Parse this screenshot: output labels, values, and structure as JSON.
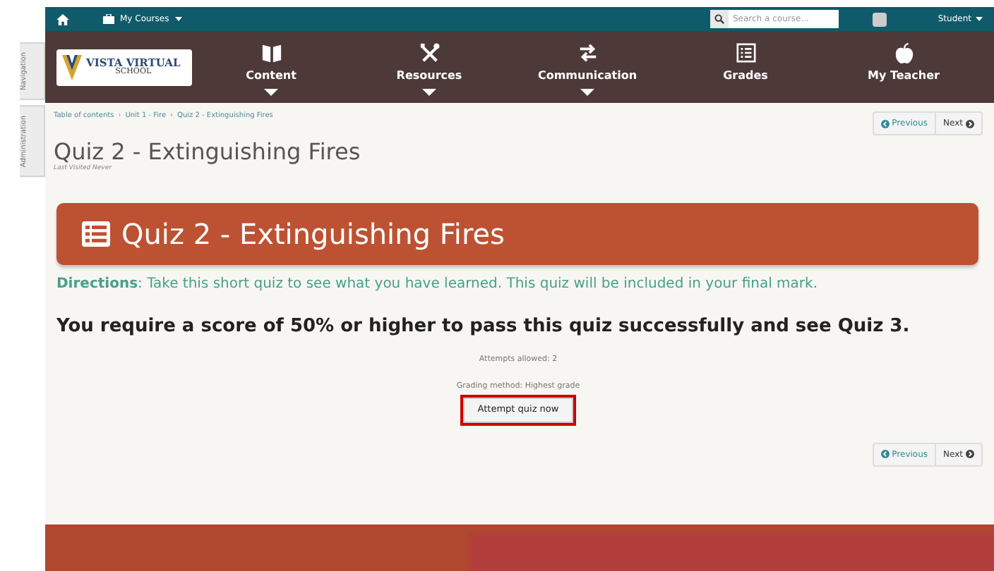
{
  "side_tabs": [
    {
      "label": "Navigation"
    },
    {
      "label": "Administration"
    }
  ],
  "top_bar": {
    "my_courses": "My Courses",
    "search": {
      "placeholder": "Search a course..."
    },
    "user": "Student"
  },
  "logo": {
    "line1": "VISTA VIRTUAL",
    "line2": "SCHOOL"
  },
  "nav_items": [
    {
      "label": "Content",
      "dropdown": true
    },
    {
      "label": "Resources",
      "dropdown": true
    },
    {
      "label": "Communication",
      "dropdown": true
    },
    {
      "label": "Grades",
      "dropdown": false
    },
    {
      "label": "My Teacher",
      "dropdown": false
    }
  ],
  "breadcrumb": [
    {
      "kind": "link",
      "text": "Table of contents"
    },
    {
      "kind": "separator",
      "text": "›"
    },
    {
      "kind": "link",
      "text": "Unit 1 - Fire"
    },
    {
      "kind": "separator",
      "text": "›"
    },
    {
      "kind": "link",
      "text": "Quiz 2 - Extinguishing Fires"
    }
  ],
  "pager": {
    "previous": "Previous",
    "next": "Next"
  },
  "page_title": "Quiz 2 - Extinguishing Fires",
  "last_visited": "Last Visited Never",
  "banner_title": "Quiz 2 - Extinguishing Fires",
  "directions": "**Directions**: Take this short quiz to see what you have learned. This quiz will be included in your final mark.",
  "requirement": "You require a score of 50% or higher to pass this quiz successfully and see Quiz 3.",
  "info": [
    "Attempts allowed: 2",
    "Grading method: Highest grade"
  ],
  "attempt_button": {
    "label": "Attempt quiz now",
    "highlighted": true
  },
  "pager_bottom": {
    "previous": "Previous",
    "next": "Next"
  }
}
